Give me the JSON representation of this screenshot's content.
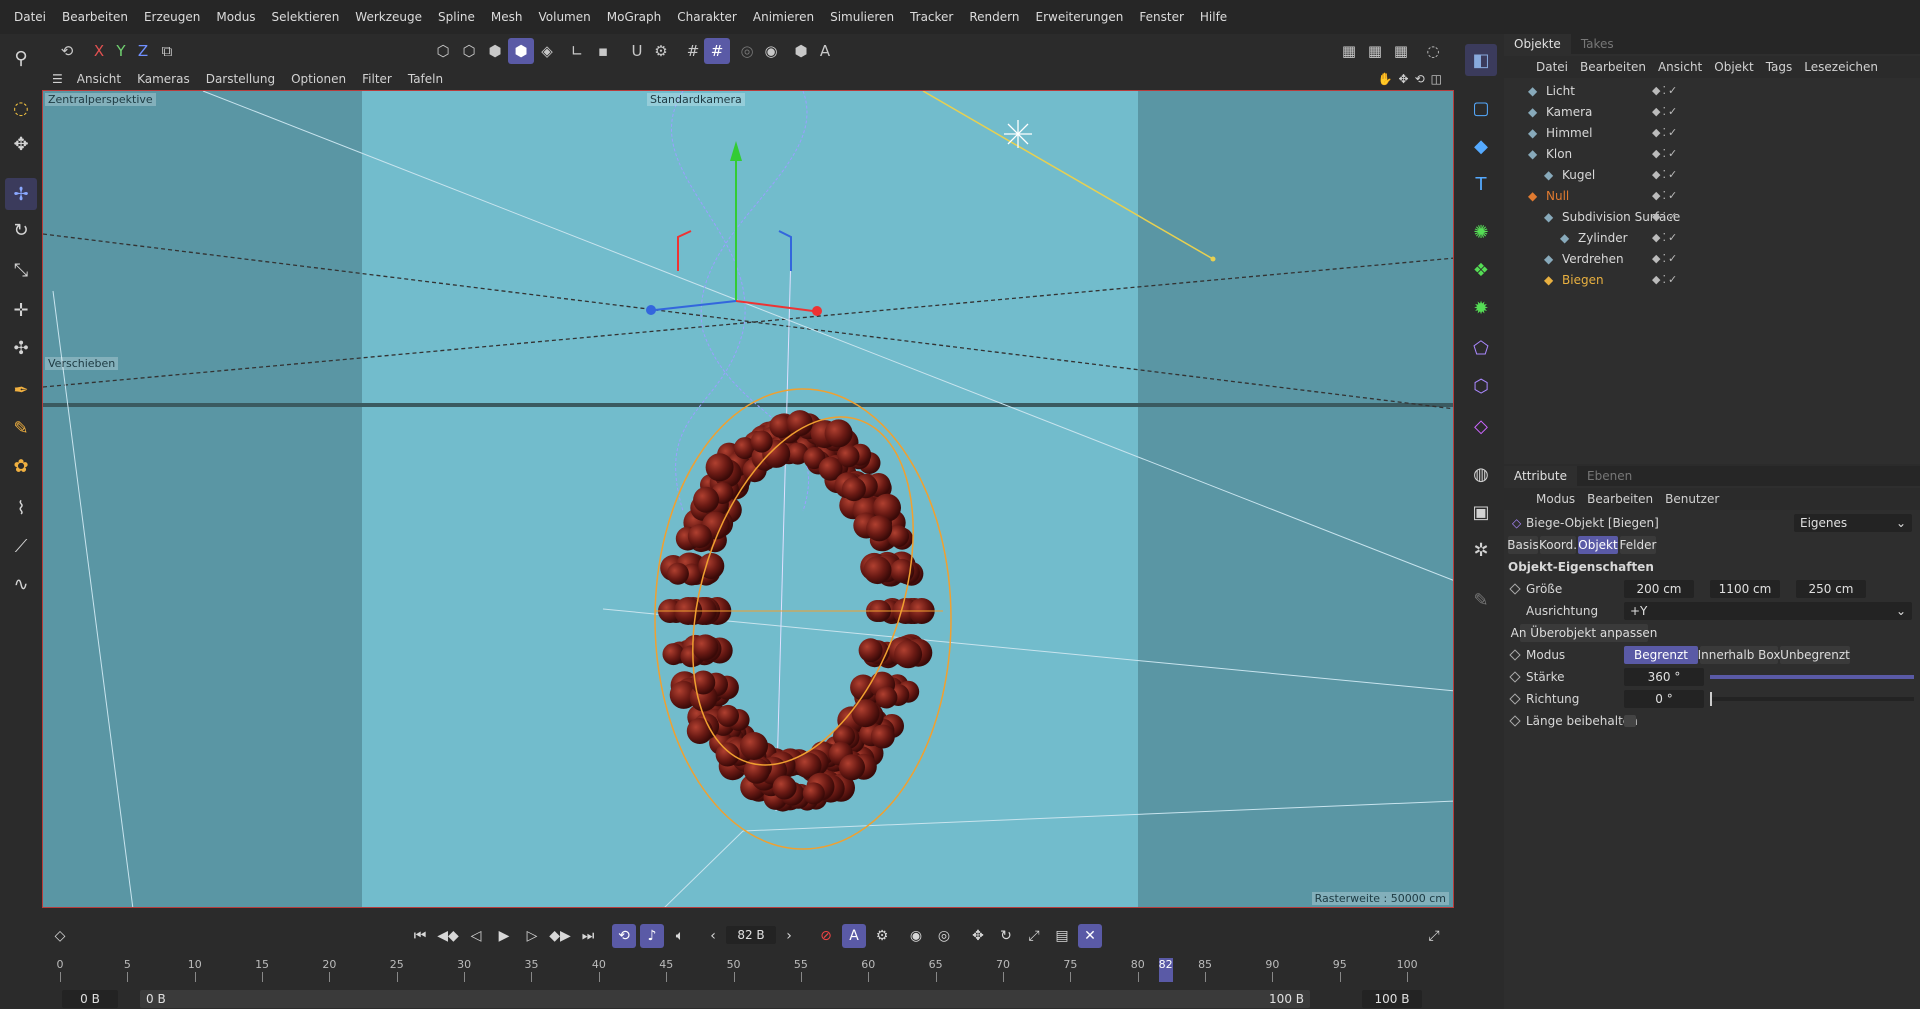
{
  "menubar": [
    "Datei",
    "Bearbeiten",
    "Erzeugen",
    "Modus",
    "Selektieren",
    "Werkzeuge",
    "Spline",
    "Mesh",
    "Volumen",
    "MoGraph",
    "Charakter",
    "Animieren",
    "Simulieren",
    "Tracker",
    "Rendern",
    "Erweiterungen",
    "Fenster",
    "Hilfe"
  ],
  "toolbar": {
    "axis_x": "X",
    "axis_y": "Y",
    "axis_z": "Z"
  },
  "viewport": {
    "menu": [
      "Ansicht",
      "Kameras",
      "Darstellung",
      "Optionen",
      "Filter",
      "Tafeln"
    ],
    "perspective_label": "Zentralperspektive",
    "camera_label": "Standardkamera",
    "tool_label": "Verschieben",
    "grid_label": "Rasterweite : 50000 cm"
  },
  "objects": {
    "tabs": [
      "Objekte",
      "Takes"
    ],
    "menu": [
      "Datei",
      "Bearbeiten",
      "Ansicht",
      "Objekt",
      "Tags",
      "Lesezeichen"
    ],
    "rows": [
      {
        "name": "Licht",
        "icon": "light-icon",
        "color": "#d8d8d8"
      },
      {
        "name": "Kamera",
        "icon": "camera-icon",
        "color": "#d8d8d8"
      },
      {
        "name": "Himmel",
        "icon": "sky-icon",
        "color": "#d8d8d8"
      },
      {
        "name": "Klon",
        "icon": "cloner-icon",
        "color": "#d8d8d8"
      },
      {
        "name": "Kugel",
        "icon": "sphere-icon",
        "color": "#d8d8d8"
      },
      {
        "name": "Null",
        "icon": "null-icon",
        "color": "#e07a30"
      },
      {
        "name": "Subdivision Surface",
        "icon": "subdivision-icon",
        "color": "#d8d8d8"
      },
      {
        "name": "Zylinder",
        "icon": "cylinder-icon",
        "color": "#d8d8d8"
      },
      {
        "name": "Verdrehen",
        "icon": "twist-icon",
        "color": "#d8d8d8"
      },
      {
        "name": "Biegen",
        "icon": "bend-icon",
        "color": "#e8b040"
      }
    ]
  },
  "attributes": {
    "tabs": [
      "Attribute",
      "Ebenen"
    ],
    "menu": [
      "Modus",
      "Bearbeiten",
      "Benutzer"
    ],
    "object_title": "Biege-Objekt [Biegen]",
    "preset": "Eigenes",
    "subtabs": [
      "Basis",
      "Koord.",
      "Objekt",
      "Felder"
    ],
    "section": "Objekt-Eigenschaften",
    "groesse_label": "Größe",
    "groesse": [
      "200 cm",
      "1100 cm",
      "250 cm"
    ],
    "ausrichtung_label": "Ausrichtung",
    "ausrichtung": "+Y",
    "fit_button": "An Überobjekt anpassen",
    "modus_label": "Modus",
    "modus_options": [
      "Begrenzt",
      "Innerhalb Box",
      "Unbegrenzt"
    ],
    "staerke_label": "Stärke",
    "staerke": "360 °",
    "staerke_fraction": 1.0,
    "richtung_label": "Richtung",
    "richtung": "0 °",
    "laenge_label": "Länge beibehalten"
  },
  "timeline": {
    "current_frame": "82 B",
    "ruler_labels": [
      "0",
      "5",
      "10",
      "15",
      "20",
      "25",
      "30",
      "35",
      "40",
      "45",
      "50",
      "55",
      "60",
      "65",
      "70",
      "75",
      "80",
      "85",
      "90",
      "95",
      "100"
    ],
    "playhead": "82",
    "start": "0 B",
    "start2": "0 B",
    "end": "100 B",
    "end2": "100 B"
  }
}
